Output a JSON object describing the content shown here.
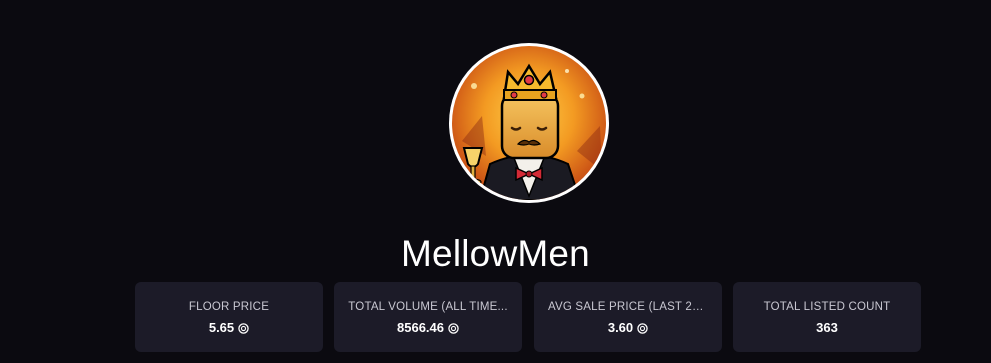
{
  "collection": {
    "name": "MellowMen",
    "avatar_icon": "mellowmen-king-avatar"
  },
  "stats": [
    {
      "label": "FLOOR PRICE",
      "value": "5.65",
      "unit_icon": "coin-icon"
    },
    {
      "label": "TOTAL VOLUME (ALL TIME...",
      "value": "8566.46",
      "unit_icon": "coin-icon"
    },
    {
      "label": "AVG SALE PRICE (LAST 24...",
      "value": "3.60",
      "unit_icon": "coin-icon"
    },
    {
      "label": "TOTAL LISTED COUNT",
      "value": "363"
    }
  ],
  "colors": {
    "background": "#0b0a10",
    "card": "#1c1b28",
    "text": "#ffffff",
    "label": "#c9c8d2"
  }
}
